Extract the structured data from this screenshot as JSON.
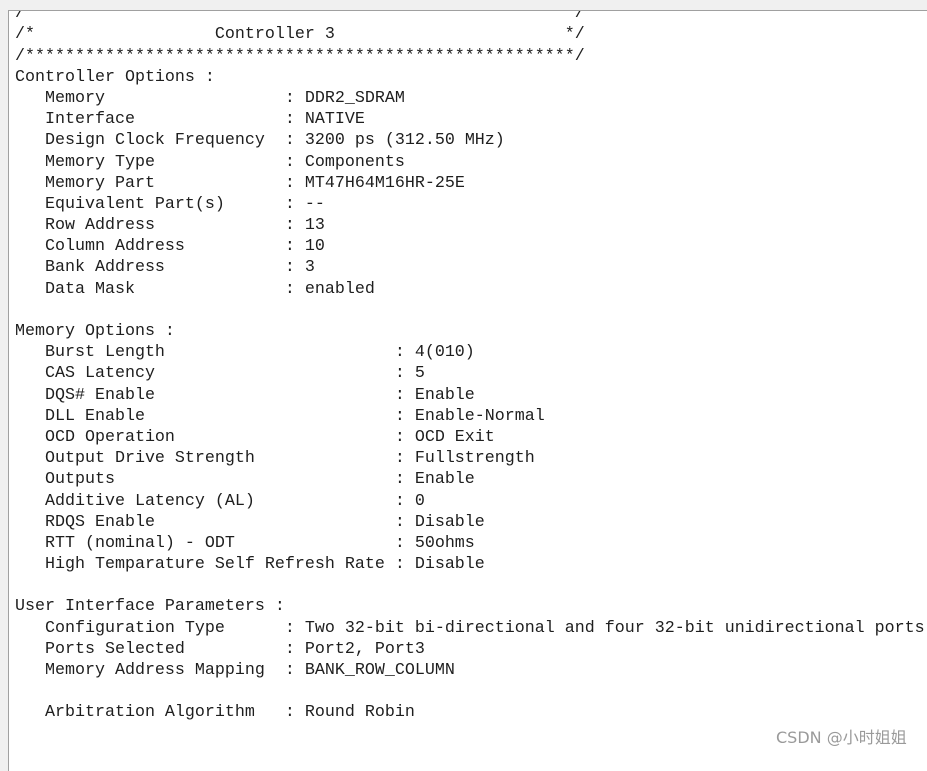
{
  "header": {
    "border_line": "/*******************************************************/",
    "title_prefix": "/*",
    "title": "Controller 3",
    "title_suffix": "*/"
  },
  "sections": [
    {
      "title": "Controller Options :",
      "items": [
        {
          "key": "Memory",
          "value": "DDR2_SDRAM"
        },
        {
          "key": "Interface",
          "value": "NATIVE"
        },
        {
          "key": "Design Clock Frequency",
          "value": "3200 ps (312.50 MHz)"
        },
        {
          "key": "Memory Type",
          "value": "Components"
        },
        {
          "key": "Memory Part",
          "value": "MT47H64M16HR-25E"
        },
        {
          "key": "Equivalent Part(s)",
          "value": "--"
        },
        {
          "key": "Row Address",
          "value": "13"
        },
        {
          "key": "Column Address",
          "value": "10"
        },
        {
          "key": "Bank Address",
          "value": "3"
        },
        {
          "key": "Data Mask",
          "value": "enabled"
        }
      ]
    },
    {
      "title": "Memory Options :",
      "items": [
        {
          "key": "Burst Length",
          "value": "4(010)"
        },
        {
          "key": "CAS Latency",
          "value": "5"
        },
        {
          "key": "DQS# Enable",
          "value": "Enable"
        },
        {
          "key": "DLL Enable",
          "value": "Enable-Normal"
        },
        {
          "key": "OCD Operation",
          "value": "OCD Exit"
        },
        {
          "key": "Output Drive Strength",
          "value": "Fullstrength"
        },
        {
          "key": "Outputs",
          "value": "Enable"
        },
        {
          "key": "Additive Latency (AL)",
          "value": "0"
        },
        {
          "key": "RDQS Enable",
          "value": "Disable"
        },
        {
          "key": "RTT (nominal) - ODT",
          "value": "50ohms"
        },
        {
          "key": "High Temparature Self Refresh Rate",
          "value": "Disable"
        }
      ]
    },
    {
      "title": "User Interface Parameters :",
      "items": [
        {
          "key": "Configuration Type",
          "value": "Two 32-bit bi-directional and four 32-bit unidirectional ports"
        },
        {
          "key": "Ports Selected",
          "value": "Port2, Port3"
        },
        {
          "key": "Memory Address Mapping",
          "value": "BANK_ROW_COLUMN"
        },
        {
          "key": "",
          "value": ""
        },
        {
          "key": "Arbitration Algorithm",
          "value": "Round Robin"
        }
      ]
    }
  ],
  "watermark": "CSDN @小时姐姐"
}
